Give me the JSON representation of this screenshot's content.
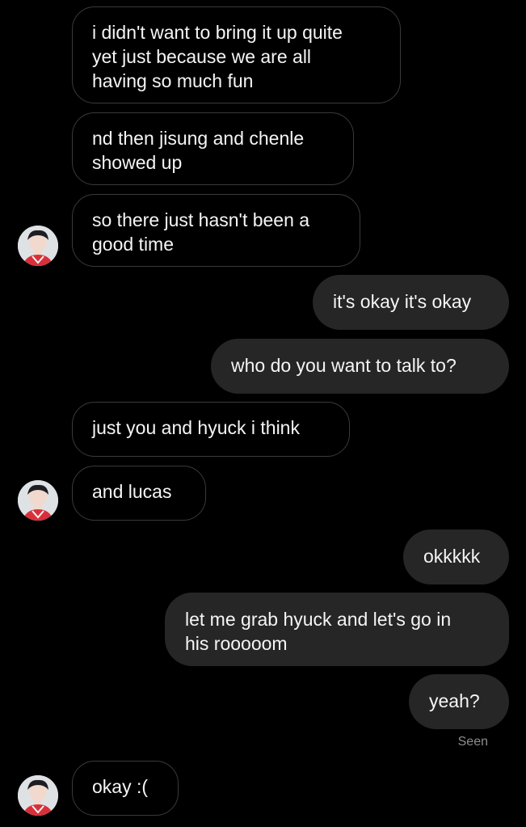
{
  "messages": [
    {
      "side": "in",
      "text": "i didn't want to bring it up quite\nyet just because we are all\nhaving so much fun"
    },
    {
      "side": "in",
      "text": "nd then jisung and chenle\nshowed up"
    },
    {
      "side": "in",
      "text": "so there just hasn't been a\ngood time"
    },
    {
      "side": "out",
      "text": "it's okay it's okay"
    },
    {
      "side": "out",
      "text": "who do you want to talk to?"
    },
    {
      "side": "in",
      "text": "just you and hyuck i think"
    },
    {
      "side": "in",
      "text": "and lucas"
    },
    {
      "side": "out",
      "text": "okkkkk"
    },
    {
      "side": "out",
      "text": "let me grab hyuck and let's go in\nhis rooooom"
    },
    {
      "side": "out",
      "text": "yeah?"
    },
    {
      "side": "in",
      "text": "okay :("
    }
  ],
  "status": {
    "seen_label": "Seen"
  },
  "colors": {
    "background": "#000000",
    "outgoing_bubble": "#262626",
    "incoming_border": "#3a3a3a",
    "seen_text": "#8e8e8e"
  }
}
